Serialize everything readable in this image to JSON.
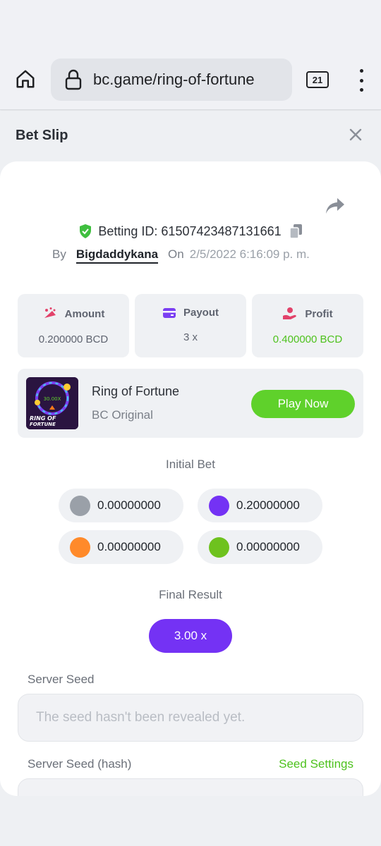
{
  "browser": {
    "url": "bc.game/ring-of-fortune",
    "tab_count": "21"
  },
  "slip": {
    "title": "Bet Slip"
  },
  "bet": {
    "id_label": "Betting ID: 61507423487131661",
    "by_label": "By",
    "user": "Bigdaddykana",
    "on_label": "On",
    "date": "2/5/2022 6:16:09 p. m."
  },
  "stats": {
    "amount_label": "Amount",
    "amount_value": "0.200000 BCD",
    "payout_label": "Payout",
    "payout_value": "3 x",
    "profit_label": "Profit",
    "profit_value": "0.400000 BCD"
  },
  "game": {
    "name": "Ring of Fortune",
    "provider": "BC Original",
    "play_label": "Play Now",
    "thumb_multiplier": "30.00X",
    "thumb_title_1": "RING OF",
    "thumb_title_2": "FORTUNE"
  },
  "initial_bet": {
    "label": "Initial Bet",
    "chips": [
      {
        "color": "#9aa0a8",
        "amount": "0.00000000"
      },
      {
        "color": "#7432f4",
        "amount": "0.20000000"
      },
      {
        "color": "#ff8a2a",
        "amount": "0.00000000"
      },
      {
        "color": "#6ec21e",
        "amount": "0.00000000"
      }
    ]
  },
  "final_result": {
    "label": "Final Result",
    "value": "3.00 x"
  },
  "server_seed": {
    "label": "Server Seed",
    "placeholder": "The seed hasn't been revealed yet."
  },
  "server_seed_hash": {
    "label": "Server Seed (hash)",
    "settings_link": "Seed Settings"
  },
  "colors": {
    "accent_purple": "#7432f4",
    "accent_green": "#5fd12b"
  }
}
